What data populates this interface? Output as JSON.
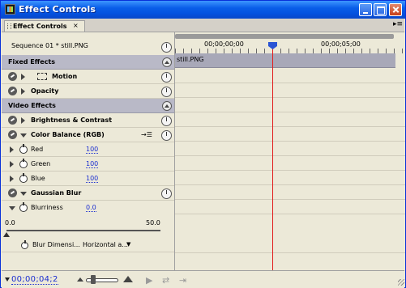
{
  "window": {
    "title": "Effect Controls"
  },
  "tab": {
    "label": "Effect Controls",
    "close": "×"
  },
  "sequence": {
    "label": "Sequence 01 * still.PNG"
  },
  "timeline": {
    "tc_start": "00;00;00;00",
    "tc_end": "00;00;05;00",
    "clip": "still.PNG"
  },
  "fixed_effects": {
    "header": "Fixed Effects",
    "motion": "Motion",
    "opacity": "Opacity"
  },
  "video_effects": {
    "header": "Video Effects",
    "brightness": "Brightness & Contrast",
    "color_balance": "Color Balance (RGB)",
    "red": {
      "label": "Red",
      "value": "100"
    },
    "green": {
      "label": "Green",
      "value": "100"
    },
    "blue": {
      "label": "Blue",
      "value": "100"
    },
    "gaussian": "Gaussian Blur",
    "blurriness": {
      "label": "Blurriness",
      "value": "0.0"
    },
    "slider": {
      "min": "0.0",
      "max": "50.0",
      "level": 0.0
    },
    "blur_dim": {
      "label": "Blur Dimensi...",
      "value": "Horizontal a..."
    }
  },
  "status": {
    "timecode": "00;00;04;2"
  },
  "colors": {
    "titlebar": "#0a5ee8",
    "header": "#b9b9c7",
    "value": "#1a2dd1",
    "playhead": "#e21d1d"
  }
}
